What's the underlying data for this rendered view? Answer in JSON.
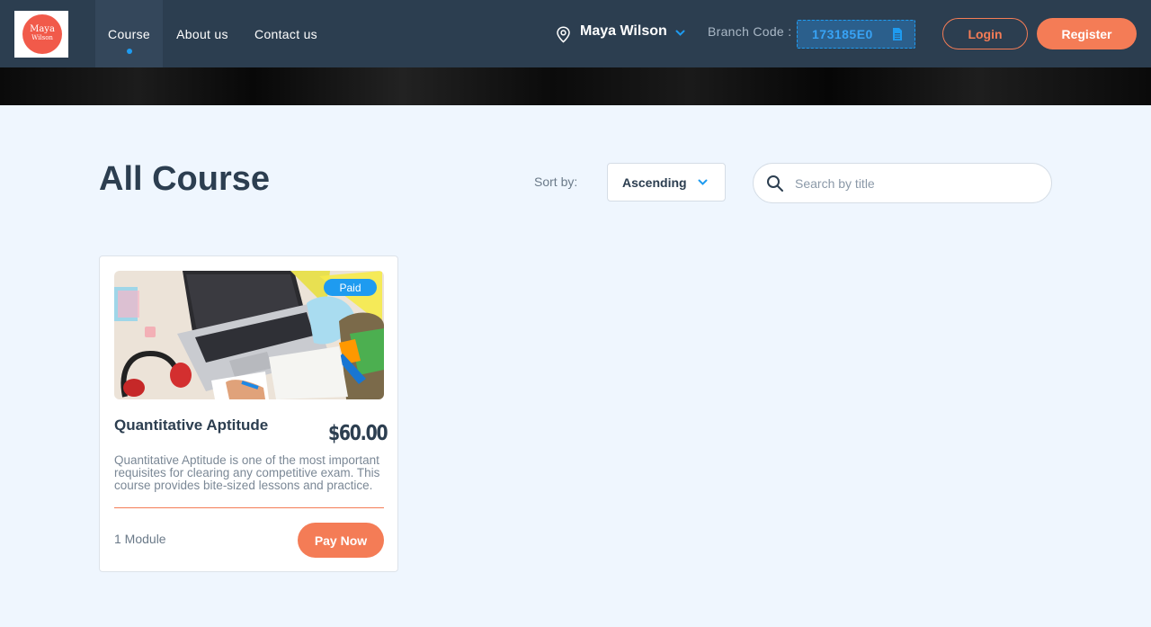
{
  "brand": {
    "logo_line1": "Maya",
    "logo_line2": "Wilson",
    "logo_color": "#f15a4a"
  },
  "nav": {
    "items": [
      {
        "label": "Course",
        "active": true
      },
      {
        "label": "About us",
        "active": false
      },
      {
        "label": "Contact us",
        "active": false
      }
    ]
  },
  "branch": {
    "icon": "location-pin-icon",
    "name": "Maya Wilson",
    "code_label": "Branch Code :",
    "code_value": "173185E0",
    "copy_icon": "copy-document-icon"
  },
  "auth": {
    "login_label": "Login",
    "register_label": "Register"
  },
  "main": {
    "title": "All Course",
    "sort_label": "Sort by:",
    "sort_value": "Ascending",
    "search_placeholder": "Search by title"
  },
  "courses": [
    {
      "badge": "Paid",
      "title": "Quantitative Aptitude",
      "price": "$60.00",
      "description": "Quantitative Aptitude is one of the most important requisites for clearing any competitive exam. This course provides bite-sized lessons and practice.",
      "modules": "1 Module",
      "action_label": "Pay Now"
    }
  ],
  "colors": {
    "nav_bg": "#2c3e50",
    "accent": "#f47c56",
    "link_blue": "#1e9bf0",
    "page_bg": "#eff6fe"
  }
}
